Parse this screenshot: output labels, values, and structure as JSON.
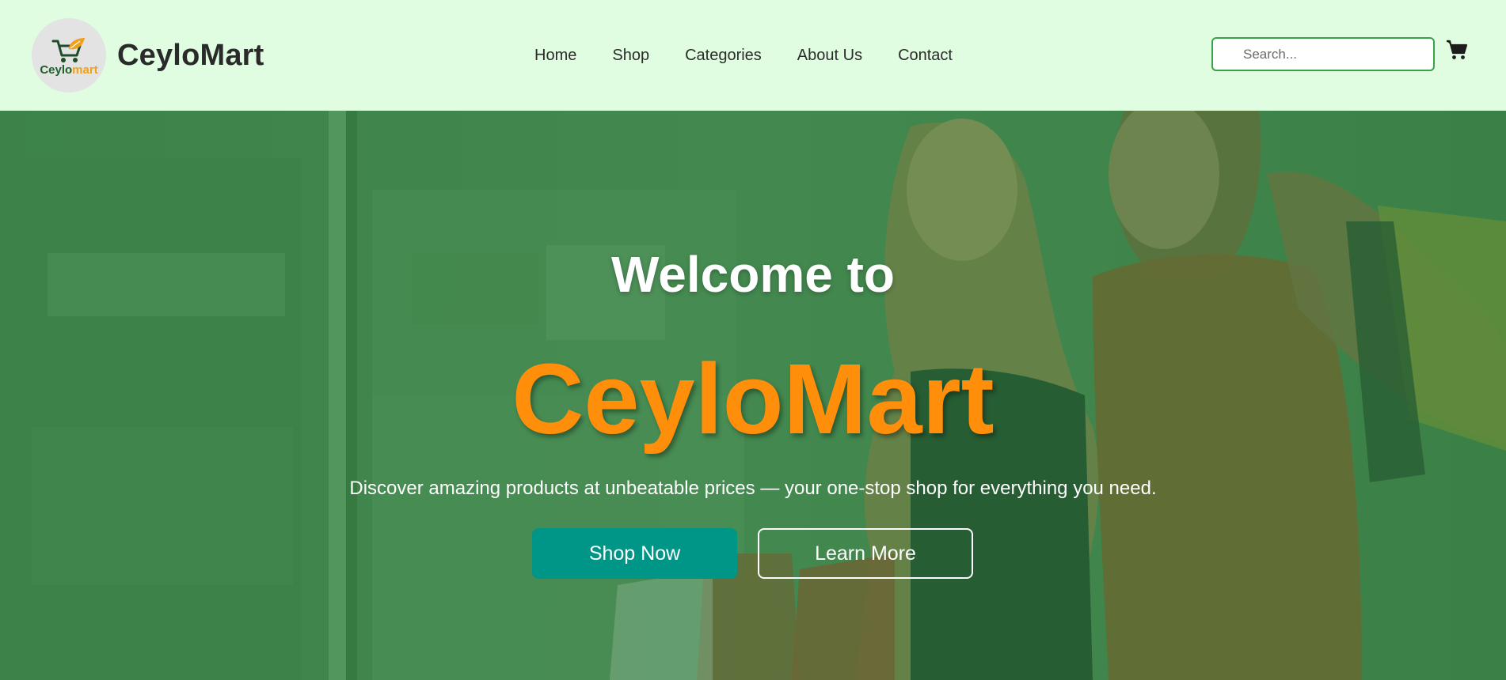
{
  "header": {
    "logo": {
      "icon": "shopping-cart-leaf-icon",
      "word_part1": "Ceylo",
      "word_part2": "mart",
      "part1_color": "#1f5f2a",
      "part2_color": "#f0a019"
    },
    "brand_name": "CeyloMart",
    "background": "#e1fde1",
    "nav": [
      {
        "label": "Home"
      },
      {
        "label": "Shop"
      },
      {
        "label": "Categories"
      },
      {
        "label": "About Us"
      },
      {
        "label": "Contact"
      }
    ],
    "search": {
      "placeholder": "Search...",
      "value": "",
      "border_color": "#3aa34a"
    },
    "cart_icon": "shopping-cart-icon"
  },
  "hero": {
    "overlay_color": "#2f7a3d",
    "welcome": "Welcome to",
    "brand": "CeyloMart",
    "brand_color": "#ff8f0a",
    "tagline": "Discover amazing products at unbeatable prices — your one-stop shop for everything you need.",
    "primary_button": {
      "label": "Shop Now",
      "color": "#009687"
    },
    "secondary_button": {
      "label": "Learn More"
    }
  }
}
